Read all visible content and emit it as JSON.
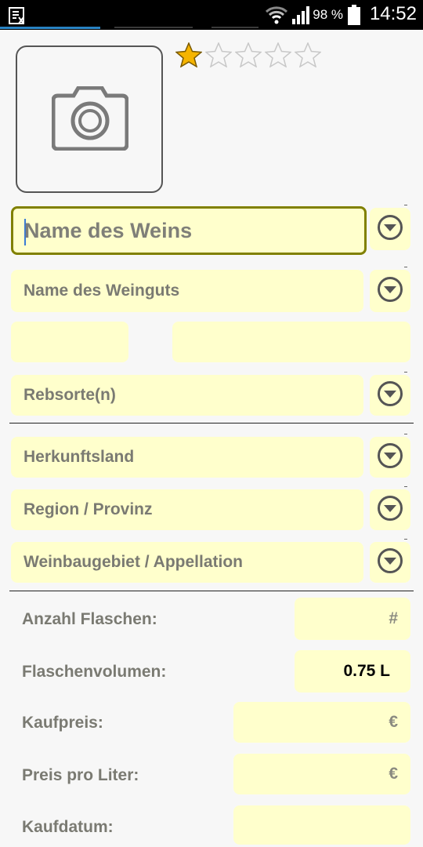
{
  "status_bar": {
    "battery_percent": "98 %",
    "time": "14:52",
    "icons": [
      "notification-icon",
      "wifi-icon",
      "signal-icon",
      "battery-icon"
    ]
  },
  "rating": {
    "value": 1,
    "max": 5
  },
  "photo": {
    "icon": "camera-icon"
  },
  "fields": {
    "wine_name": {
      "placeholder": "Name des Weins"
    },
    "winery_name": {
      "placeholder": "Name des Weinguts"
    },
    "grape_varieties": {
      "placeholder": "Rebsorte(n)"
    },
    "country": {
      "placeholder": "Herkunftsland"
    },
    "region": {
      "placeholder": "Region / Provinz"
    },
    "appellation": {
      "placeholder": "Weinbaugebiet / Appellation"
    }
  },
  "details": {
    "bottle_count": {
      "label": "Anzahl Flaschen:",
      "placeholder": "#"
    },
    "bottle_volume": {
      "label": "Flaschenvolumen:",
      "value": "0.75 L"
    },
    "purchase_price": {
      "label": "Kaufpreis:",
      "placeholder": "€"
    },
    "price_per_liter": {
      "label": "Preis pro Liter:",
      "placeholder": "€"
    },
    "purchase_date": {
      "label": "Kaufdatum:"
    }
  },
  "colors": {
    "field_background": "#ffffcc",
    "focus_border": "#808000",
    "star_filled": "#f5b400",
    "status_bar": "#000000"
  }
}
